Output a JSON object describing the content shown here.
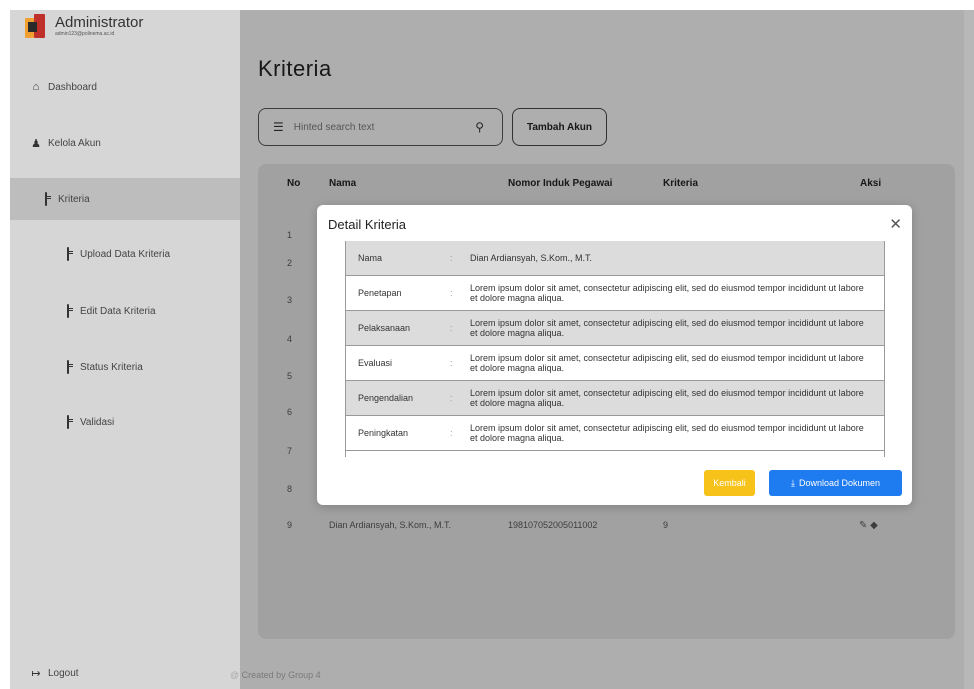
{
  "sidebar": {
    "brand_title": "Administrator",
    "brand_sub": "admin123@polinema.ac.id",
    "items": [
      {
        "label": "Dashboard",
        "icon": "home-icon"
      },
      {
        "label": "Kelola Akun",
        "icon": "user-icon"
      },
      {
        "label": "Kriteria",
        "icon": "clipboard-icon"
      },
      {
        "label": "Upload Data Kriteria",
        "icon": "clipboard-icon"
      },
      {
        "label": "Edit Data Kriteria",
        "icon": "clipboard-icon"
      },
      {
        "label": "Status Kriteria",
        "icon": "clipboard-icon"
      },
      {
        "label": "Validasi",
        "icon": "clipboard-icon"
      }
    ],
    "logout": "Logout"
  },
  "main": {
    "title": "Kriteria",
    "search_placeholder": "Hinted search text",
    "add_button": "Tambah Akun",
    "columns": [
      "No",
      "Nama",
      "Nomor Induk Pegawai",
      "Kriteria",
      "Aksi"
    ],
    "row_numbers": [
      "1",
      "2",
      "3",
      "4",
      "5",
      "6",
      "7",
      "8"
    ],
    "last_row": {
      "no": "9",
      "nama": "Dian Ardiansyah, S.Kom., M.T.",
      "nip": "198107052005011002",
      "kriteria": "9"
    }
  },
  "footer": "@ Created by Group 4",
  "modal": {
    "title": "Detail Kriteria",
    "rows": [
      {
        "label": "Nama",
        "value": "Dian Ardiansyah, S.Kom., M.T."
      },
      {
        "label": "Penetapan",
        "value": "Lorem ipsum dolor sit amet, consectetur adipiscing elit, sed do eiusmod tempor incididunt ut labore et dolore magna aliqua."
      },
      {
        "label": "Pelaksanaan",
        "value": "Lorem ipsum dolor sit amet, consectetur adipiscing elit, sed do eiusmod tempor incididunt ut labore et dolore magna aliqua."
      },
      {
        "label": "Evaluasi",
        "value": "Lorem ipsum dolor sit amet, consectetur adipiscing elit, sed do eiusmod tempor incididunt ut labore et dolore magna aliqua."
      },
      {
        "label": "Pengendalian",
        "value": "Lorem ipsum dolor sit amet, consectetur adipiscing elit, sed do eiusmod tempor incididunt ut labore et dolore magna aliqua."
      },
      {
        "label": "Peningkatan",
        "value": "Lorem ipsum dolor sit amet, consectetur adipiscing elit, sed do eiusmod tempor incididunt ut labore et dolore magna aliqua."
      }
    ],
    "separator": ":",
    "back_button": "Kembali",
    "download_button": "Download Dokumen"
  },
  "colors": {
    "sidebar_bg": "#d6d6d6",
    "active_bg": "#bdbdbd",
    "kembali": "#f7c21a",
    "download": "#1e7bf0"
  }
}
